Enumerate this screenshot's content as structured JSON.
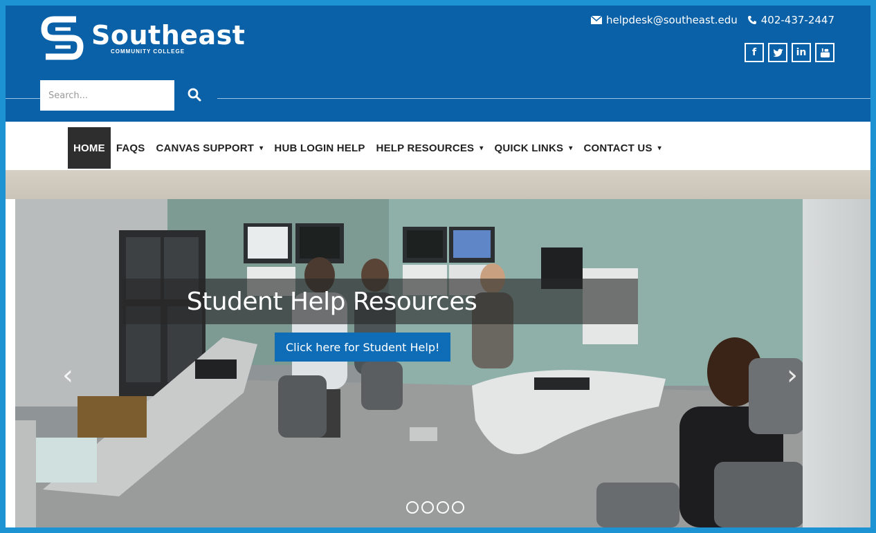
{
  "header": {
    "logo_name": "Southeast",
    "logo_subtitle": "COMMUNITY COLLEGE",
    "email": "helpdesk@southeast.edu",
    "phone": "402-437-2447",
    "social": [
      {
        "label": "f",
        "icon": "facebook-icon"
      },
      {
        "label": "t",
        "icon": "twitter-icon"
      },
      {
        "label": "in",
        "icon": "linkedin-icon"
      },
      {
        "label": "yt",
        "icon": "youtube-icon"
      }
    ],
    "search_placeholder": "Search...",
    "brand_color": "#0b61a8"
  },
  "nav": {
    "items": [
      {
        "label": "HOME",
        "active": true,
        "dropdown": false
      },
      {
        "label": "FAQS",
        "active": false,
        "dropdown": false
      },
      {
        "label": "CANVAS SUPPORT",
        "active": false,
        "dropdown": true
      },
      {
        "label": "HUB LOGIN HELP",
        "active": false,
        "dropdown": false
      },
      {
        "label": "HELP RESOURCES",
        "active": false,
        "dropdown": true
      },
      {
        "label": "QUICK LINKS",
        "active": false,
        "dropdown": true
      },
      {
        "label": "CONTACT US",
        "active": false,
        "dropdown": true
      }
    ],
    "caret": "▾"
  },
  "hero": {
    "title": "Student Help Resources",
    "cta_label": "Click here for Student Help!",
    "prev": "‹",
    "next": "›",
    "slide_count": 4
  }
}
